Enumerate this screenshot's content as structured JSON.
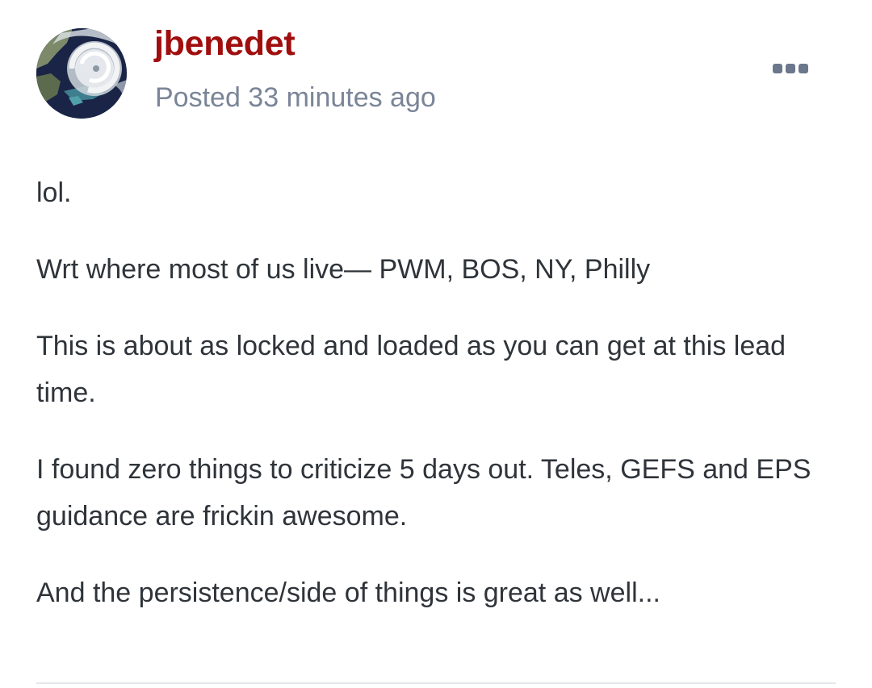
{
  "post": {
    "author": "jbenedet",
    "timestamp": "Posted 33 minutes ago",
    "paragraphs": [
      "lol.",
      "Wrt where most of us live— PWM, BOS, NY, Philly",
      "This is about as locked and loaded as you can get at this lead time.",
      "I found zero things to criticize 5 days out. Teles, GEFS and EPS guidance are frickin awesome.",
      "And the persistence/side of things is great as well..."
    ],
    "menu_icon": "ellipsis-icon",
    "avatar_icon": "hurricane-satellite-avatar"
  },
  "colors": {
    "author": "#a00e0e",
    "timestamp": "#7a8597",
    "body_text": "#2f343a",
    "menu_icon": "#6b778b",
    "divider": "#e4e7eb"
  }
}
